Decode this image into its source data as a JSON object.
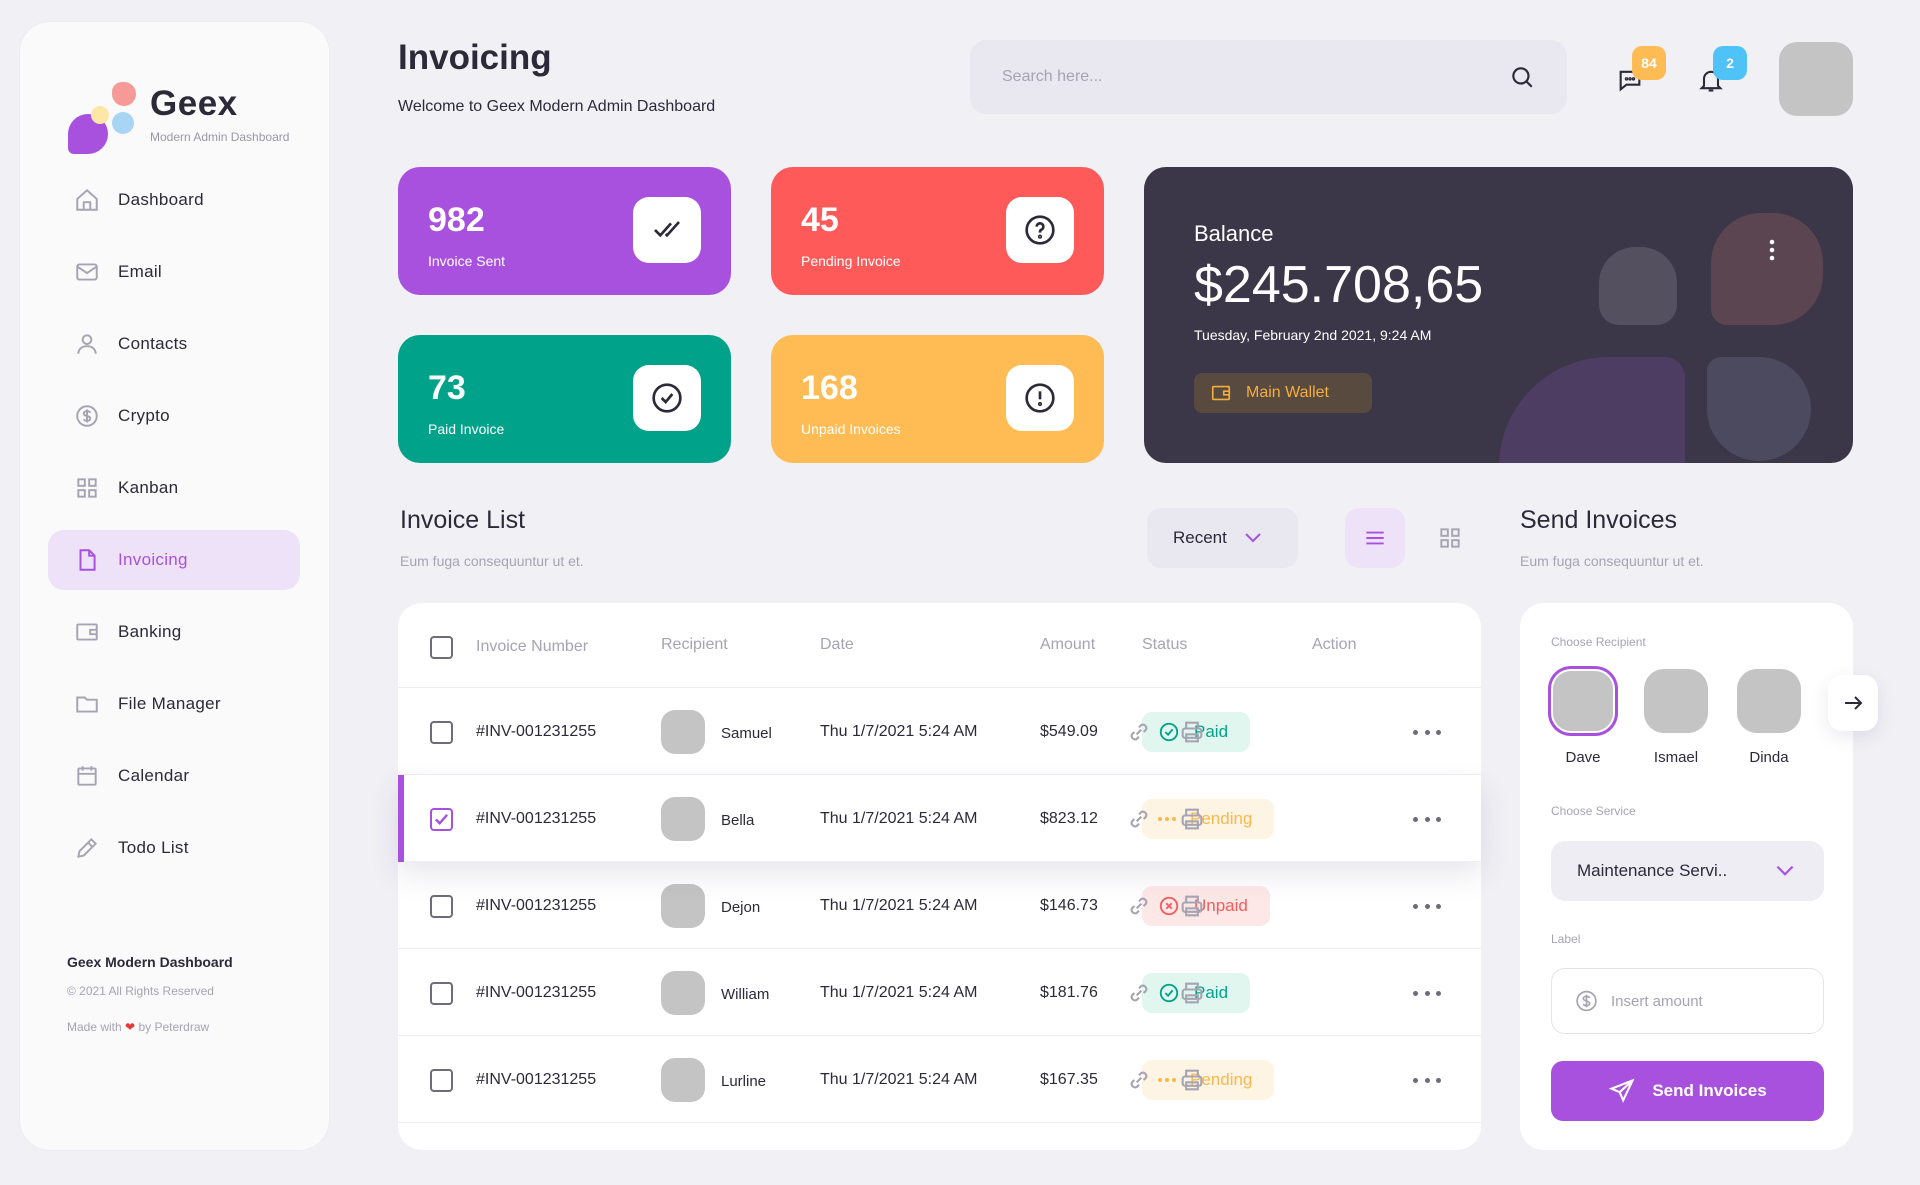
{
  "app": {
    "name": "Geex",
    "tagline": "Modern Admin Dashboard"
  },
  "sidebar": {
    "items": [
      {
        "label": "Dashboard",
        "icon": "home-icon"
      },
      {
        "label": "Email",
        "icon": "mail-icon"
      },
      {
        "label": "Contacts",
        "icon": "user-icon"
      },
      {
        "label": "Crypto",
        "icon": "dollar-icon"
      },
      {
        "label": "Kanban",
        "icon": "grid-icon"
      },
      {
        "label": "Invoicing",
        "icon": "document-icon",
        "active": true
      },
      {
        "label": "Banking",
        "icon": "wallet-icon"
      },
      {
        "label": "File Manager",
        "icon": "folder-icon"
      },
      {
        "label": "Calendar",
        "icon": "calendar-icon"
      },
      {
        "label": "Todo List",
        "icon": "pencil-icon"
      }
    ],
    "footer": {
      "title": "Geex Modern Dashboard",
      "copyright": "© 2021 All Rights Reserved",
      "made_with_prefix": "Made with",
      "made_with_suffix": "by Peterdraw"
    }
  },
  "header": {
    "title": "Invoicing",
    "subtitle": "Welcome to Geex Modern Admin Dashboard",
    "search_placeholder": "Search here...",
    "messages_badge": "84",
    "notifications_badge": "2"
  },
  "stats": [
    {
      "value": "982",
      "label": "Invoice Sent",
      "color": "#A851DE",
      "icon": "double-check-icon"
    },
    {
      "value": "45",
      "label": "Pending Invoice",
      "color": "#FF5A5A",
      "icon": "question-icon"
    },
    {
      "value": "73",
      "label": "Paid Invoice",
      "color": "#00A389",
      "icon": "check-circle-icon"
    },
    {
      "value": "168",
      "label": "Unpaid Invoices",
      "color": "#FFBB54",
      "icon": "alert-icon"
    }
  ],
  "balance": {
    "label": "Balance",
    "amount": "$245.708,65",
    "date": "Tuesday, February 2nd 2021, 9:24 AM",
    "wallet_label": "Main Wallet"
  },
  "invoice_list": {
    "title": "Invoice List",
    "subtitle": "Eum fuga consequuntur ut et.",
    "filter": "Recent",
    "columns": [
      "Invoice Number",
      "Recipient",
      "Date",
      "Amount",
      "Status",
      "Action"
    ],
    "rows": [
      {
        "number": "#INV-001231255",
        "recipient": "Samuel",
        "date": "Thu 1/7/2021 5:24 AM",
        "amount": "$549.09",
        "status": "Paid",
        "selected": false
      },
      {
        "number": "#INV-001231255",
        "recipient": "Bella",
        "date": "Thu 1/7/2021 5:24 AM",
        "amount": "$823.12",
        "status": "Pending",
        "selected": true
      },
      {
        "number": "#INV-001231255",
        "recipient": "Dejon",
        "date": "Thu 1/7/2021 5:24 AM",
        "amount": "$146.73",
        "status": "Unpaid",
        "selected": false
      },
      {
        "number": "#INV-001231255",
        "recipient": "William",
        "date": "Thu 1/7/2021 5:24 AM",
        "amount": "$181.76",
        "status": "Paid",
        "selected": false
      },
      {
        "number": "#INV-001231255",
        "recipient": "Lurline",
        "date": "Thu 1/7/2021 5:24 AM",
        "amount": "$167.35",
        "status": "Pending",
        "selected": false
      }
    ]
  },
  "send_invoices": {
    "title": "Send Invoices",
    "subtitle": "Eum fuga consequuntur ut et.",
    "recipient_label": "Choose Recipient",
    "recipients": [
      "Dave",
      "Ismael",
      "Dinda"
    ],
    "service_label": "Choose Service",
    "service_value": "Maintenance Servi..",
    "amount_label": "Label",
    "amount_placeholder": "Insert amount",
    "button_label": "Send Invoices"
  },
  "colors": {
    "accent": "#A851DE",
    "paid": "#00A389",
    "pending": "#F9B84C",
    "unpaid": "#F55C5C",
    "balance_bg": "#3B3648"
  }
}
